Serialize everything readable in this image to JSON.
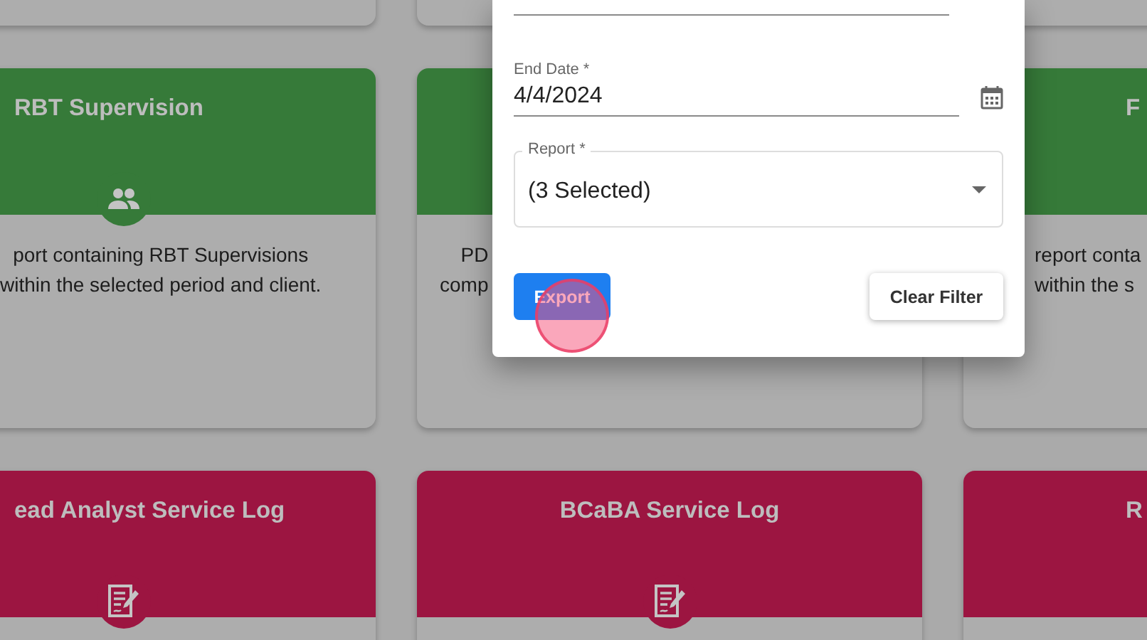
{
  "card_rows": [
    {
      "cards": [
        {
          "title": "RBT Supervision",
          "kind": "people",
          "color": "#367a39",
          "description_lines": [
            "port containing RBT Supervisions",
            "within the selected period and client."
          ]
        },
        {
          "color": "#367a39",
          "description_lines": [
            "PD",
            "comp"
          ]
        },
        {
          "title": "F",
          "color": "#367a39",
          "description_lines": [
            "report conta",
            "within the s"
          ]
        }
      ]
    },
    {
      "cards": [
        {
          "title": "ead Analyst Service Log",
          "kind": "document",
          "color": "#9c1541"
        },
        {
          "title": "BCaBA Service Log",
          "kind": "document",
          "color": "#9c1541"
        },
        {
          "title": "R",
          "color": "#9c1541"
        }
      ]
    }
  ],
  "dialog": {
    "end_date": {
      "label": "End Date *",
      "value": "4/4/2024"
    },
    "report": {
      "label": "Report *",
      "value": "(3 Selected)"
    },
    "buttons": [
      {
        "label": "Export",
        "kind": "primary"
      },
      {
        "label": "Clear Filter",
        "kind": "secondary"
      }
    ]
  }
}
